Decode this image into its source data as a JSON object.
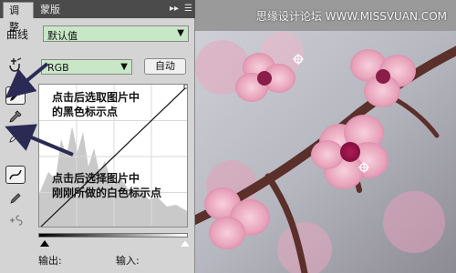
{
  "tabs": {
    "adjust": "调整",
    "mask": "蒙版"
  },
  "panel": {
    "curve_label": "曲线",
    "preset_value": "默认值",
    "channel_value": "RGB",
    "auto_button": "自动",
    "output_label": "输出:",
    "input_label": "输入:"
  },
  "annotations": {
    "line1": "点击后选取图片中",
    "line2": "的黑色标示点",
    "line3": "点击后选择图片中",
    "line4": "刚刚所做的白色标示点"
  },
  "watermark": "思缘设计论坛 WWW.MISSVUAN.COM",
  "colors": {
    "accent_arrow": "#2a2a55",
    "select_bg": "#c7e7c7"
  },
  "icons": {
    "hand": "target-adjust-icon",
    "black_point": "eyedropper-black-icon",
    "gray_point": "eyedropper-gray-icon",
    "white_point": "eyedropper-white-icon",
    "curve_tool": "curve-tool-icon",
    "pencil_tool": "pencil-icon",
    "smooth_tool": "smooth-icon"
  }
}
